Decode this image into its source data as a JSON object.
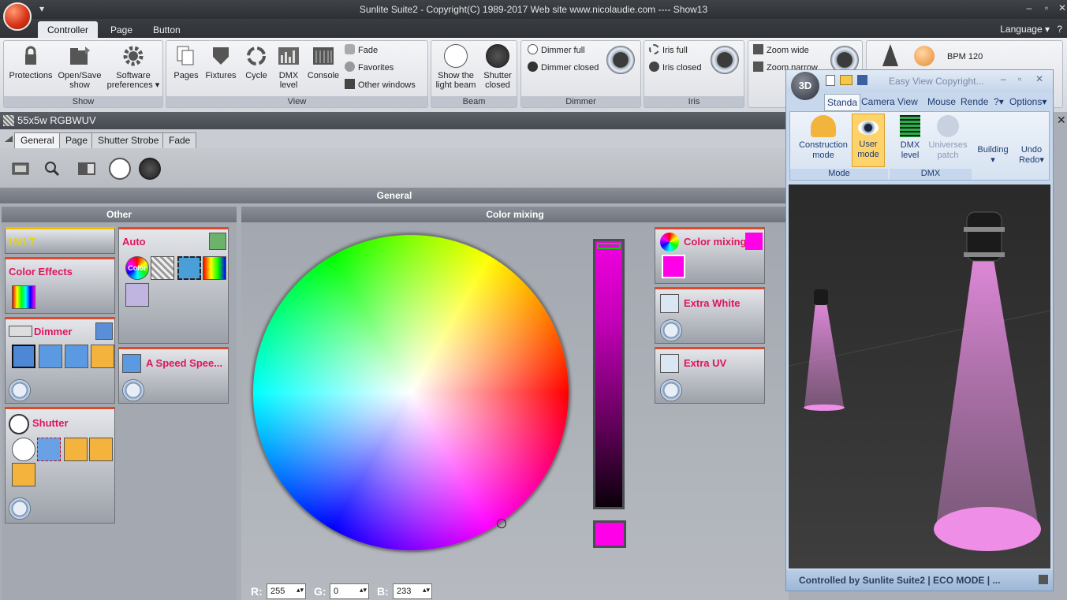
{
  "app": {
    "title": "Sunlite Suite2 - Copyright(C) 1989-2017   Web site www.nicolaudie.com ---- Show13"
  },
  "ribbon_tabs": [
    "Controller",
    "Page",
    "Button"
  ],
  "language": "Language",
  "help": "?",
  "groups": {
    "show": {
      "caption": "Show",
      "protections": "Protections",
      "open_save_1": "Open/Save",
      "open_save_2": "show",
      "software_1": "Software",
      "software_2": "preferences"
    },
    "view": {
      "caption": "View",
      "pages": "Pages",
      "fixtures": "Fixtures",
      "cycle": "Cycle",
      "dmx_1": "DMX",
      "dmx_2": "level",
      "console": "Console",
      "fade": "Fade",
      "favorites": "Favorites",
      "other_windows": "Other windows"
    },
    "beam": {
      "caption": "Beam",
      "show_1": "Show the",
      "show_2": "light beam",
      "shutter_1": "Shutter",
      "shutter_2": "closed"
    },
    "dimmer": {
      "caption": "Dimmer",
      "full": "Dimmer full",
      "closed": "Dimmer closed"
    },
    "iris": {
      "caption": "Iris",
      "full": "Iris full",
      "closed": "Iris closed"
    },
    "zoom": {
      "wide": "Zoom wide",
      "narrow": "Zoom narrow"
    },
    "bpm": "BPM 120"
  },
  "fixture": {
    "name": "55x5w RGBWUV",
    "tabs": [
      "General",
      "Page",
      "Shutter Strobe",
      "Fade"
    ]
  },
  "sections": {
    "general": "General",
    "other": "Other",
    "color_mixing": "Color mixing"
  },
  "panels": {
    "init": "INIT",
    "color_effects": "Color Effects",
    "dimmer": "Dimmer",
    "shutter": "Shutter",
    "auto": "Auto",
    "speed": "A Speed Spee...",
    "color_mixing": "Color mixing",
    "extra_white": "Extra White",
    "extra_uv": "Extra UV",
    "color_icon_text": "Color"
  },
  "rgb": {
    "r_label": "R:",
    "r": "255",
    "g_label": "G:",
    "g": "0",
    "b_label": "B:",
    "b": "233"
  },
  "colors": {
    "selected": "#ff00e9",
    "accent": "#e0145f",
    "header_red": "#e2492a"
  },
  "win3d": {
    "title": "Easy View  Copyright...",
    "tabs": [
      "Standa",
      "Camera",
      "View",
      "Mouse",
      "Rende",
      "?",
      "Options"
    ],
    "construction_1": "Construction",
    "construction_2": "mode",
    "user_1": "User",
    "user_2": "mode",
    "dmx_1": "DMX",
    "dmx_2": "level",
    "universes_1": "Universes",
    "universes_2": "patch",
    "building": "Building",
    "undo": "Undo",
    "redo": "Redo",
    "group_mode": "Mode",
    "group_dmx": "DMX",
    "status": "Controlled by Sunlite Suite2  |  ECO MODE  |  ..."
  }
}
